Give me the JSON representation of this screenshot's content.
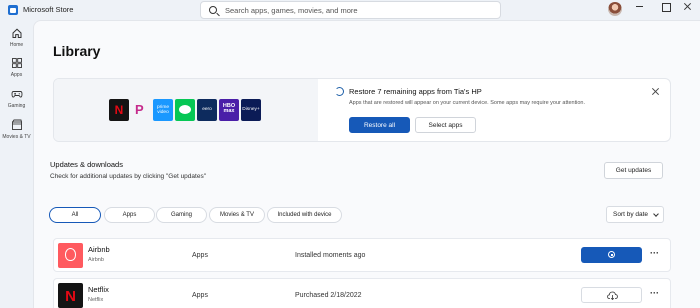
{
  "window": {
    "title": "Microsoft Store",
    "search_placeholder": "Search apps, games, movies, and more"
  },
  "sidebar": {
    "items": [
      {
        "label": "Home",
        "icon": "home-icon"
      },
      {
        "label": "Apps",
        "icon": "apps-icon"
      },
      {
        "label": "Gaming",
        "icon": "gaming-icon"
      },
      {
        "label": "Movies & TV",
        "icon": "movies-tv-icon"
      }
    ]
  },
  "page": {
    "title": "Library"
  },
  "restore": {
    "title": "Restore 7 remaining apps from Tia's HP",
    "description": "Apps that are restored will appear on your current device. Some apps may require your attention.",
    "restore_all_label": "Restore all",
    "select_apps_label": "Select apps",
    "tiles": {
      "prime": "prime video",
      "eero": "eero",
      "hbo": "HBO max",
      "disney": "Disney+"
    }
  },
  "updates": {
    "heading": "Updates & downloads",
    "subtext": "Check for additional updates by clicking \"Get updates\"",
    "button_label": "Get updates"
  },
  "filters": {
    "items": [
      "All",
      "Apps",
      "Gaming",
      "Movies & TV",
      "Included with device"
    ],
    "active": "All",
    "sort_label": "Sort by date"
  },
  "apps": [
    {
      "name": "Airbnb",
      "publisher": "Airbnb",
      "category": "Apps",
      "status": "Installed moments ago",
      "action": "stop-icon"
    },
    {
      "name": "Netflix",
      "publisher": "Netflix",
      "category": "Apps",
      "status": "Purchased 2/18/2022",
      "action": "cloud-download-icon"
    }
  ],
  "colors": {
    "accent": "#1659b8",
    "background": "#eef2f7",
    "airbnb": "#ff5a5f",
    "netflix_red": "#e50914"
  }
}
